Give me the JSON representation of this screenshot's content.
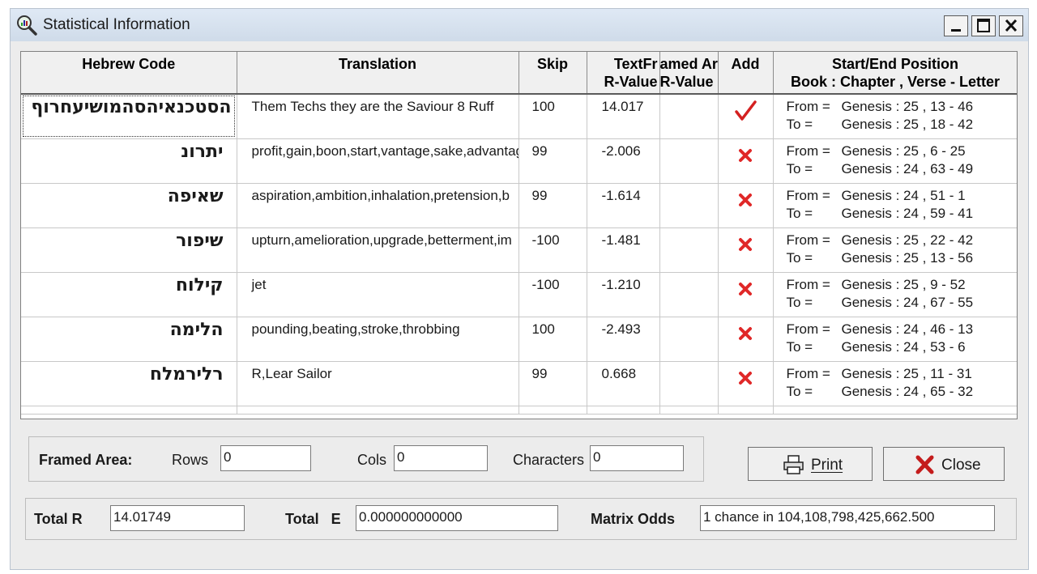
{
  "window": {
    "title": "Statistical Information"
  },
  "columns": {
    "hebrew_code": "Hebrew Code",
    "translation": "Translation",
    "skip": "Skip",
    "text_line1": "TextFr",
    "text_line2": "R-Value",
    "framed_line1": "amed Ar",
    "framed_line2": "R-Value",
    "add": "Add",
    "pos_line1": "Start/End Position",
    "pos_line2": "Book : Chapter , Verse - Letter"
  },
  "labels": {
    "from": "From =",
    "to": "To ="
  },
  "rows": [
    {
      "hebrew": "הסטכנאיהסהמושיעחרוף",
      "translation": "Them Techs they are the Saviour 8 Ruff",
      "skip": "100",
      "text_r": "14.017",
      "framed_r": "",
      "added": true,
      "from": "Genesis : 25 , 13 - 46",
      "to": "Genesis : 25 , 18 - 42"
    },
    {
      "hebrew": "יתרונ",
      "translation": "profit,gain,boon,start,vantage,sake,advantage",
      "skip": "99",
      "text_r": "-2.006",
      "framed_r": "",
      "added": false,
      "from": "Genesis : 25 , 6 - 25",
      "to": "Genesis : 24 , 63 - 49"
    },
    {
      "hebrew": "שאיפה",
      "translation": "aspiration,ambition,inhalation,pretension,b",
      "skip": "99",
      "text_r": "-1.614",
      "framed_r": "",
      "added": false,
      "from": "Genesis : 24 , 51 - 1",
      "to": "Genesis : 24 , 59 - 41"
    },
    {
      "hebrew": "שיפור",
      "translation": "upturn,amelioration,upgrade,betterment,im",
      "skip": "-100",
      "text_r": "-1.481",
      "framed_r": "",
      "added": false,
      "from": "Genesis : 25 , 22 - 42",
      "to": "Genesis : 25 , 13 - 56"
    },
    {
      "hebrew": "קילוח",
      "translation": "jet",
      "skip": "-100",
      "text_r": "-1.210",
      "framed_r": "",
      "added": false,
      "from": "Genesis : 25 , 9 - 52",
      "to": "Genesis : 24 , 67 - 55"
    },
    {
      "hebrew": "הלימה",
      "translation": "pounding,beating,stroke,throbbing",
      "skip": "100",
      "text_r": "-2.493",
      "framed_r": "",
      "added": false,
      "from": "Genesis : 24 , 46 - 13",
      "to": "Genesis : 24 , 53 - 6"
    },
    {
      "hebrew": "רלירמלח",
      "translation": "R,Lear Sailor",
      "skip": "99",
      "text_r": "0.668",
      "framed_r": "",
      "added": false,
      "from": "Genesis : 25 , 11 - 31",
      "to": "Genesis : 24 , 65 - 32"
    }
  ],
  "framed_area": {
    "label": "Framed Area:",
    "rows_label": "Rows",
    "rows_value": "0",
    "cols_label": "Cols",
    "cols_value": "0",
    "chars_label": "Characters",
    "chars_value": "0"
  },
  "buttons": {
    "print": "Print",
    "close": "Close"
  },
  "totals": {
    "total_r_label": "Total R",
    "total_r_value": "14.01749",
    "total_e_label": "Total   E",
    "total_e_value": "0.000000000000",
    "odds_label": "Matrix Odds",
    "odds_value": "1 chance in 104,108,798,425,662.500"
  },
  "colors": {
    "check": "#d42020",
    "cross": "#e02828",
    "titlebar": "#d6e2ef"
  },
  "icons": {
    "title": "magnifier-chart-icon",
    "check": "checkmark-icon",
    "cross": "x-mark-icon",
    "print": "printer-icon",
    "close": "close-x-icon"
  }
}
